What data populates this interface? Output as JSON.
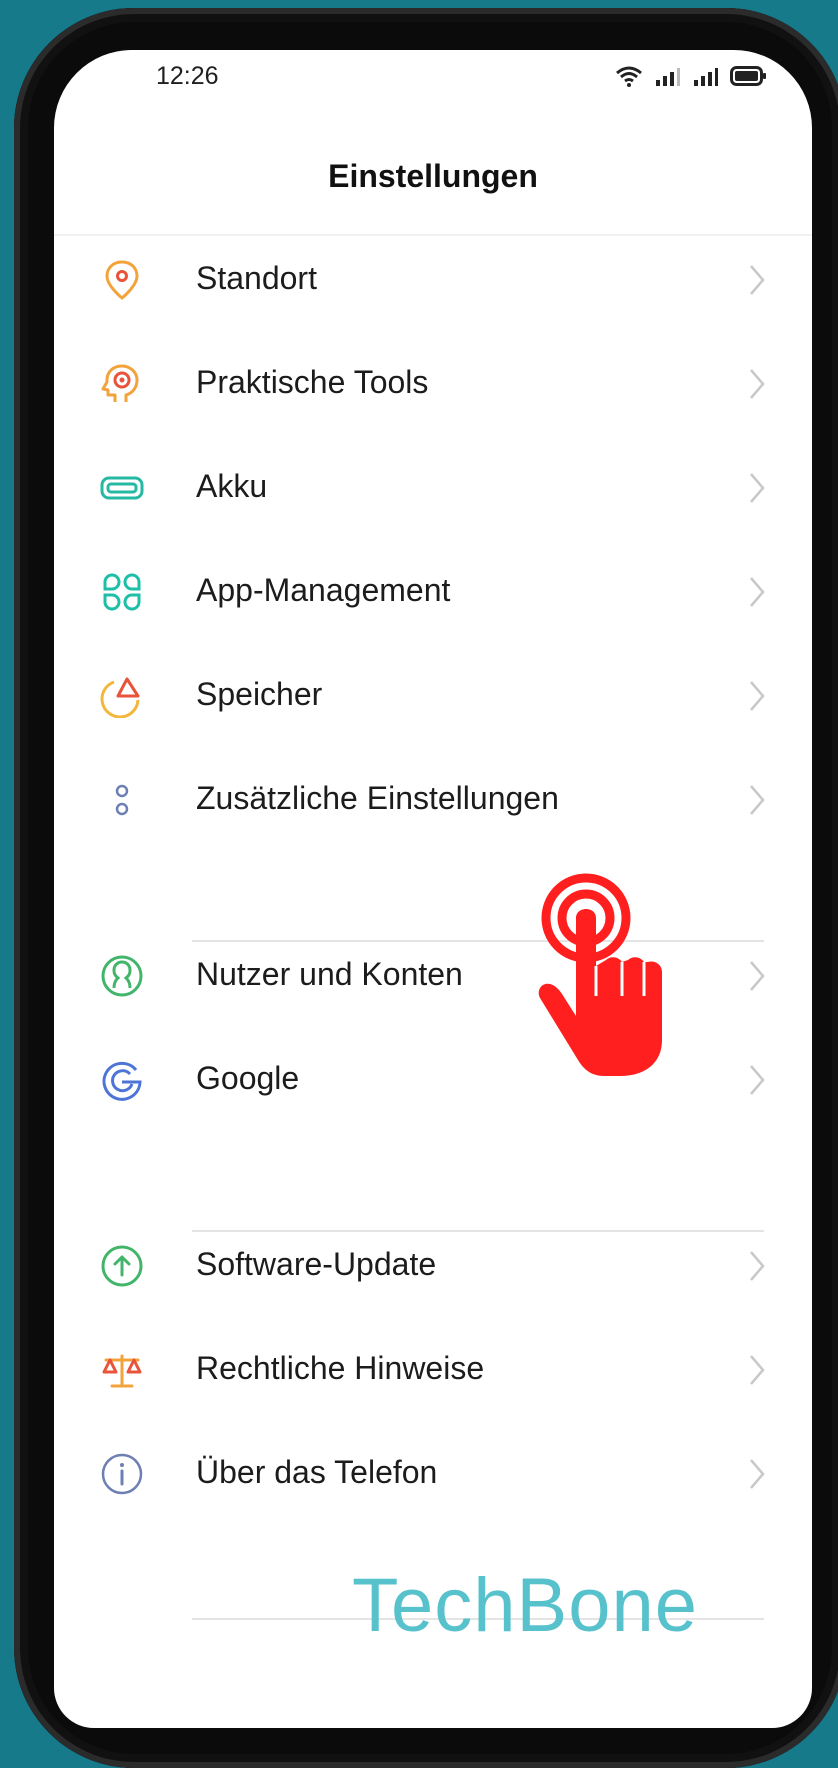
{
  "status_bar": {
    "time": "12:26",
    "icons": [
      "wifi-icon",
      "signal-icon",
      "signal-icon",
      "battery-icon"
    ]
  },
  "header": {
    "title": "Einstellungen"
  },
  "items": [
    {
      "label": "Standort",
      "icon": "location-pin-icon",
      "color": "#f3a33b"
    },
    {
      "label": "Praktische Tools",
      "icon": "tools-head-icon",
      "color": "#f0762f"
    },
    {
      "label": "Akku",
      "icon": "battery-icon",
      "color": "#25b8a3"
    },
    {
      "label": "App-Management",
      "icon": "app-grid-icon",
      "color": "#1dbfa8"
    },
    {
      "label": "Speicher",
      "icon": "storage-pie-icon",
      "color": "#f2b73b"
    },
    {
      "label": "Zusätzliche Einstellungen",
      "icon": "more-dots-icon",
      "color": "#6d7fb3"
    },
    {
      "label": "Nutzer und Konten",
      "icon": "user-account-icon",
      "color": "#43b56b"
    },
    {
      "label": "Google",
      "icon": "google-g-icon",
      "color": "#4d74d6"
    },
    {
      "label": "Software-Update",
      "icon": "update-arrow-icon",
      "color": "#43b56b"
    },
    {
      "label": "Rechtliche Hinweise",
      "icon": "scales-icon",
      "color": "#f07a2f"
    },
    {
      "label": "Über das Telefon",
      "icon": "info-icon",
      "color": "#6d7fb3"
    }
  ],
  "watermark": "TechBone",
  "tap_indicator_color": "#ff1f1f"
}
